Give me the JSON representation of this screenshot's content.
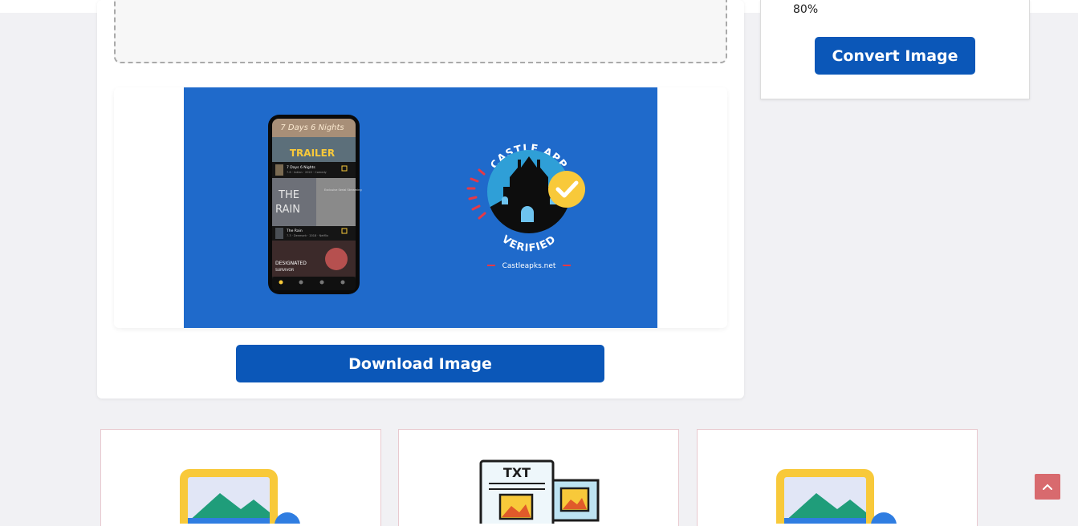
{
  "converter": {
    "quality_label": "80%",
    "convert_label": "Convert Image",
    "download_label": "Download Image"
  },
  "preview": {
    "verified_top": "CASTLE APP",
    "verified_bottom": "VERIFIED",
    "site": "Castleapks.net",
    "phone": {
      "banner_script": "7 Days 6 Nights",
      "banner_label": "TRAILER",
      "item1_title": "7 Days 6 Nights",
      "item1_meta": "7.6 · Indian · 2022 · Comedy",
      "poster2_line1": "THE",
      "poster2_line2": "RAIN",
      "poster2_tag": "Exclusive Serial Streaming",
      "item2_title": "The Rain",
      "item2_meta": "7.3 · Denmark · 2018 · Netflix",
      "poster3_line1": "DESIGNATED",
      "poster3_line2": "SURVIVOR"
    }
  },
  "tools": [
    {
      "icon": "image-convert-icon"
    },
    {
      "icon": "txt-image-icon"
    },
    {
      "icon": "image-convert-icon"
    }
  ],
  "colors": {
    "primary": "#0b57b8",
    "preview_bg": "#1f6acb",
    "accent_yellow": "#f8c93a",
    "scroll_top": "#d86a6e"
  }
}
